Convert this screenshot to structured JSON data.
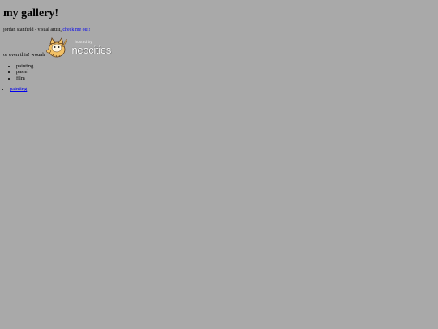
{
  "page": {
    "title": "my gallery!",
    "intro_text": "jordan stanfield - visual artist, ",
    "intro_link": "check me out!",
    "badge_prefix": "or even this! wouah",
    "badge": {
      "hosted_by": "hosted by",
      "brand": "neocities",
      "icon": "neocities-cat-icon"
    },
    "media": [
      "painting",
      "pastel",
      "film"
    ],
    "links": [
      "painting"
    ]
  },
  "colors": {
    "background": "#a9a9a9",
    "link": "#0000ee"
  }
}
